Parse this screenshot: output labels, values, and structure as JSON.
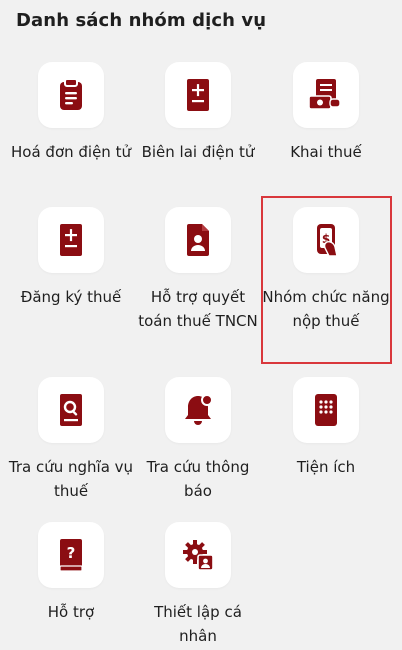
{
  "header": {
    "title": "Danh sách nhóm dịch vụ"
  },
  "brand_color": "#8b0d12",
  "highlight_color": "#d9373c",
  "tiles": [
    {
      "label": "Hoá đơn điện tử",
      "icon": "clipboard-icon"
    },
    {
      "label": "Biên lai điện tử",
      "icon": "receipt-plus-minus-icon"
    },
    {
      "label": "Khai thuế",
      "icon": "tax-declaration-cash-icon"
    },
    {
      "label": "Đăng ký thuế",
      "icon": "register-plus-minus-icon"
    },
    {
      "label": "Hỗ trợ quyết toán thuế TNCN",
      "icon": "user-document-icon"
    },
    {
      "label": "Nhóm chức năng nộp thuế",
      "icon": "tax-payment-hand-icon"
    },
    {
      "label": "Tra cứu nghĩa vụ thuế",
      "icon": "search-document-icon"
    },
    {
      "label": "Tra cứu thông báo",
      "icon": "bell-icon"
    },
    {
      "label": "Tiện ích",
      "icon": "keypad-icon"
    },
    {
      "label": "Hỗ trợ",
      "icon": "help-book-icon"
    },
    {
      "label": "Thiết lập cá nhân",
      "icon": "settings-profile-icon"
    }
  ]
}
